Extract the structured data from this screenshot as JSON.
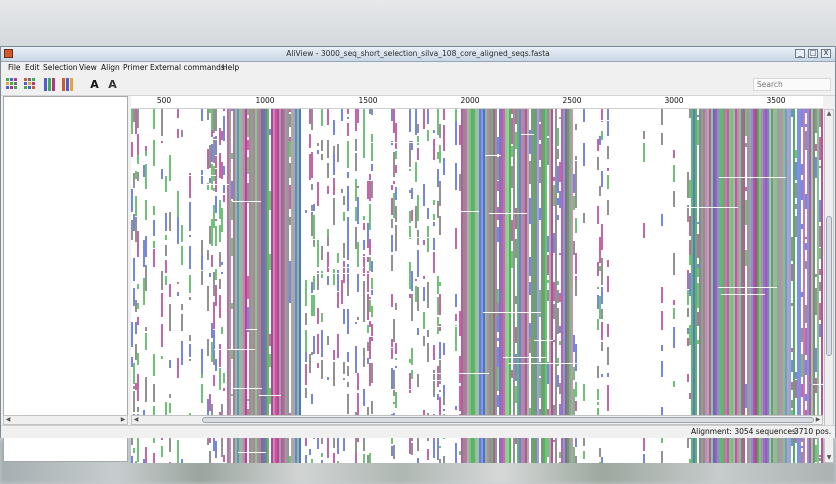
{
  "window": {
    "title": "AliView - 3000_seq_short_selection_silva_108_core_aligned_seqs.fasta",
    "controls": {
      "minimize": "_",
      "maximize": "□",
      "close": "X"
    }
  },
  "menu": [
    "File",
    "Edit",
    "Selection",
    "View",
    "Align",
    "Primer",
    "External commands",
    "Help"
  ],
  "toolbar": {
    "buttons": [
      {
        "icon": "color-grid-icon"
      },
      {
        "icon": "color-grid-alt-icon"
      },
      {
        "icon": "color-bars-icon"
      },
      {
        "icon": "color-bars-alt-icon"
      },
      {
        "icon": "font-a-icon",
        "glyph": "A"
      },
      {
        "icon": "font-a-bold-icon",
        "glyph": "A"
      }
    ],
    "search_placeholder": "Search"
  },
  "ruler": {
    "ticks": [
      "500",
      "1000",
      "1500",
      "2000",
      "2500",
      "3000",
      "3500"
    ]
  },
  "status": {
    "sequences": "Alignment: 3054 sequences",
    "positions": "3710 pos."
  },
  "colors": {
    "nucleotide_a": "#3fae4a",
    "nucleotide_c": "#4a5fd1",
    "nucleotide_g": "#6e6e6e",
    "nucleotide_t": "#b0348c",
    "window_border": "#7e8a96"
  }
}
